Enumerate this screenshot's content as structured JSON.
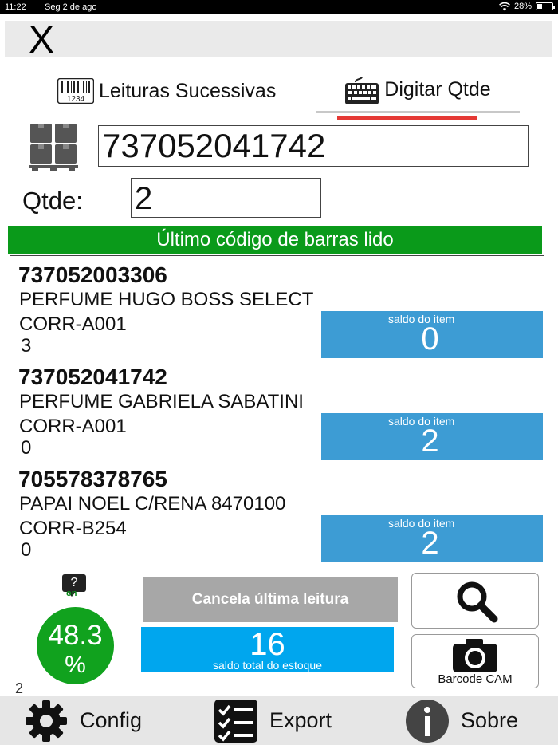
{
  "status": {
    "time": "11:22",
    "date": "Seg 2 de ago",
    "battery": "28%",
    "battery_level": 0.28
  },
  "header": {
    "close_label": "X"
  },
  "tabs": [
    {
      "label": "Leituras Sucessivas",
      "icon": "barcode-1234-icon",
      "active": false
    },
    {
      "label": "Digitar Qtde",
      "icon": "keyboard-icon",
      "active": true
    }
  ],
  "barcode_input": {
    "value": "737052041742"
  },
  "qtde": {
    "label": "Qtde:",
    "value": "2"
  },
  "banner": "Último código de barras lido",
  "items": [
    {
      "code": "737052003306",
      "description": "PERFUME HUGO BOSS SELECT",
      "location": "CORR-A001",
      "quantity": "3",
      "saldo_label": "saldo do item",
      "saldo_value": "0"
    },
    {
      "code": "737052041742",
      "description": "PERFUME GABRIELA SABATINI",
      "location": "CORR-A001",
      "quantity": "0",
      "saldo_label": "saldo do item",
      "saldo_value": "2"
    },
    {
      "code": "705578378765",
      "description": "PAPAI NOEL C/RENA 8470100",
      "location": "CORR-B254",
      "quantity": "0",
      "saldo_label": "saldo do item",
      "saldo_value": "2"
    }
  ],
  "help": {
    "glyph": "?",
    "status": "on"
  },
  "progress": {
    "value": "48.3",
    "symbol": "%"
  },
  "counter": "2",
  "cancel_button": "Cancela última leitura",
  "total": {
    "value": "16",
    "label": "saldo total do estoque"
  },
  "camera": {
    "label": "Barcode CAM"
  },
  "bottom_nav": {
    "config": "Config",
    "export": "Export",
    "sobre": "Sobre"
  },
  "colors": {
    "green": "#0a9a1a",
    "blue_saldo": "#3d9cd4",
    "blue_total": "#00a6ee",
    "tab_underline": "#e53935",
    "cancel_gray": "#a7a7a7"
  }
}
